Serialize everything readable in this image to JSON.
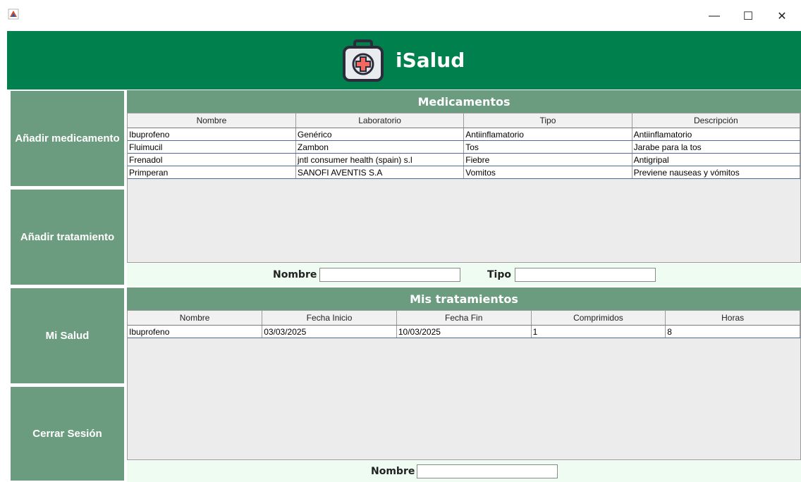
{
  "window": {
    "minimize_glyph": "—",
    "maximize_glyph": "☐",
    "close_glyph": "✕"
  },
  "header": {
    "title": "iSalud"
  },
  "sidebar": {
    "items": [
      {
        "label": "Añadir medicamento"
      },
      {
        "label": "Añadir tratamiento"
      },
      {
        "label": "Mi Salud"
      },
      {
        "label": "Cerrar Sesión"
      }
    ]
  },
  "medicamentos": {
    "title": "Medicamentos",
    "columns": [
      "Nombre",
      "Laboratorio",
      "Tipo",
      "Descripción"
    ],
    "rows": [
      [
        "Ibuprofeno",
        "Genérico",
        "Antiinflamatorio",
        "Antiinflamatorio"
      ],
      [
        "Fluimucil",
        "Zambon",
        "Tos",
        "Jarabe para la tos"
      ],
      [
        "Frenadol",
        "jntl consumer health (spain) s.l",
        "Fiebre",
        "Antigripal"
      ],
      [
        "Primperan",
        "SANOFI AVENTIS S.A",
        "Vomitos",
        "Previene nauseas y vómitos"
      ]
    ],
    "filter": {
      "nombre_label": "Nombre",
      "nombre_value": "",
      "tipo_label": "Tipo",
      "tipo_value": ""
    }
  },
  "tratamientos": {
    "title": "Mis tratamientos",
    "columns": [
      "Nombre",
      "Fecha Inicio",
      "Fecha Fin",
      "Comprimidos",
      "Horas"
    ],
    "rows": [
      [
        "Ibuprofeno",
        "03/03/2025",
        "10/03/2025",
        "1",
        "8"
      ]
    ],
    "filter": {
      "nombre_label": "Nombre",
      "nombre_value": ""
    }
  },
  "colors": {
    "header_green": "#00804c",
    "sidebar_green": "#6c9c7f",
    "filter_bg": "#eefcf2"
  }
}
